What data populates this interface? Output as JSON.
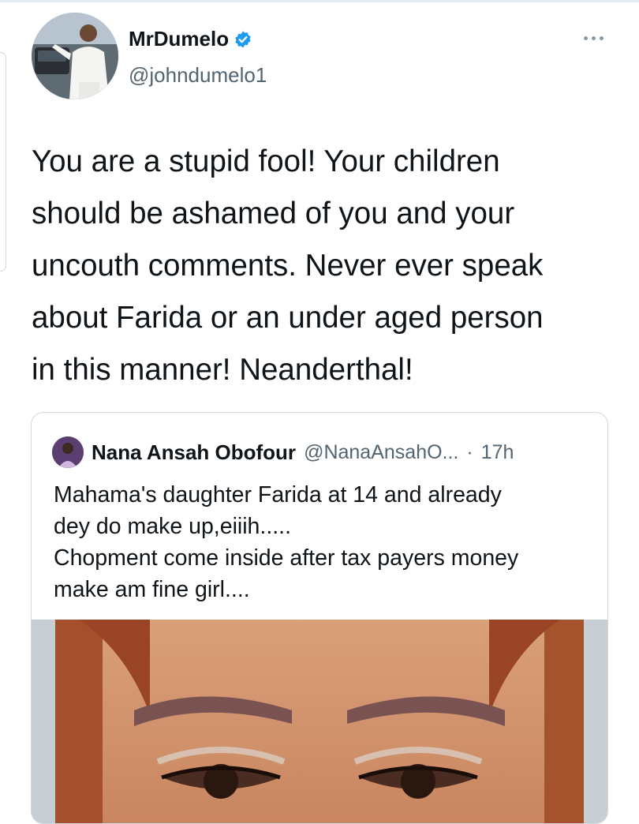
{
  "tweet": {
    "display_name": "MrDumelo",
    "handle": "@johndumelo1",
    "verified": true,
    "more_icon": "more-options-icon",
    "text_lines": [
      "You are a stupid fool! Your children",
      "should be ashamed of you and your",
      "uncouth comments. Never ever speak",
      "about Farida or an under aged person",
      "in this manner! Neanderthal!"
    ]
  },
  "quote": {
    "display_name": "Nana Ansah Obofour",
    "handle": "@NanaAnsahO...",
    "separator": "·",
    "time": "17h",
    "text_lines": [
      "Mahama's daughter Farida at 14 and already",
      "dey do make up,eiiih.....",
      "Chopment come inside after tax payers money",
      "make am fine girl...."
    ]
  },
  "colors": {
    "verified": "#1d9bf0",
    "secondary_text": "#536471",
    "border": "#cfd9de"
  }
}
